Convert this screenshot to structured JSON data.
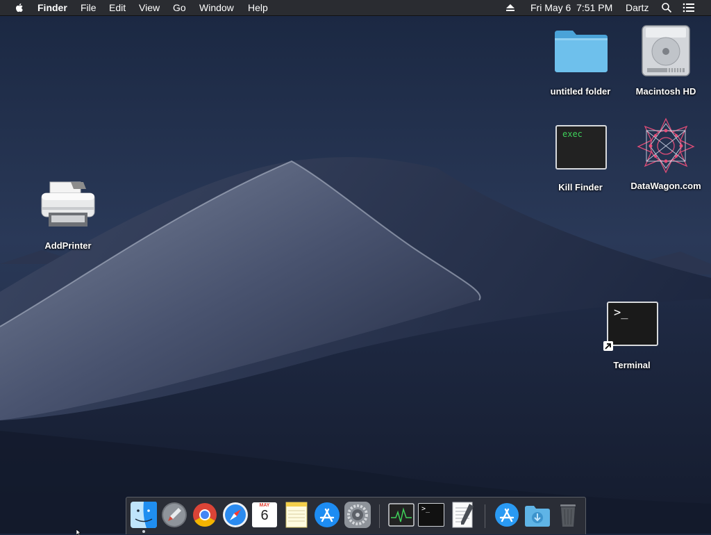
{
  "menubar": {
    "app_name": "Finder",
    "menus": [
      "File",
      "Edit",
      "View",
      "Go",
      "Window",
      "Help"
    ],
    "datetime": "Fri May 6  7:51 PM",
    "user": "Dartz",
    "icons": [
      "apple-icon",
      "eject-icon",
      "spotlight-icon",
      "notification-list-icon"
    ]
  },
  "desktop": {
    "icons": [
      {
        "label": "untitled folder",
        "icon": "folder-icon"
      },
      {
        "label": "Macintosh HD",
        "icon": "hard-drive-icon"
      },
      {
        "label": "Kill Finder",
        "icon": "exec-script-icon",
        "badge": "exec"
      },
      {
        "label": "DataWagon.com",
        "icon": "datawagon-logo-icon"
      },
      {
        "label": "AddPrinter",
        "icon": "printer-icon"
      },
      {
        "label": "Terminal",
        "icon": "terminal-alias-icon",
        "badge": ">_"
      }
    ]
  },
  "dock": {
    "items": [
      {
        "name": "Finder",
        "icon": "finder-icon",
        "running": true
      },
      {
        "name": "Launchpad",
        "icon": "launchpad-icon"
      },
      {
        "name": "Chrome",
        "icon": "chrome-icon"
      },
      {
        "name": "Safari",
        "icon": "safari-icon"
      },
      {
        "name": "Calendar",
        "icon": "calendar-icon",
        "month": "MAY",
        "day": "6"
      },
      {
        "name": "Notes",
        "icon": "notes-icon"
      },
      {
        "name": "App Store",
        "icon": "app-store-icon"
      },
      {
        "name": "System Preferences",
        "icon": "system-preferences-icon"
      },
      {
        "name": "Activity Monitor",
        "icon": "activity-monitor-icon"
      },
      {
        "name": "Terminal",
        "icon": "terminal-icon"
      },
      {
        "name": "TextEdit",
        "icon": "textedit-icon"
      },
      {
        "name": "Applications",
        "icon": "applications-stack-icon"
      },
      {
        "name": "Downloads",
        "icon": "downloads-stack-icon"
      },
      {
        "name": "Trash",
        "icon": "trash-icon"
      }
    ]
  },
  "colors": {
    "menubar_bg": "#2a2c31",
    "sky_top": "#1c2a45",
    "dune_light": "#8a93a8",
    "folder_blue": "#5fb4e6"
  }
}
